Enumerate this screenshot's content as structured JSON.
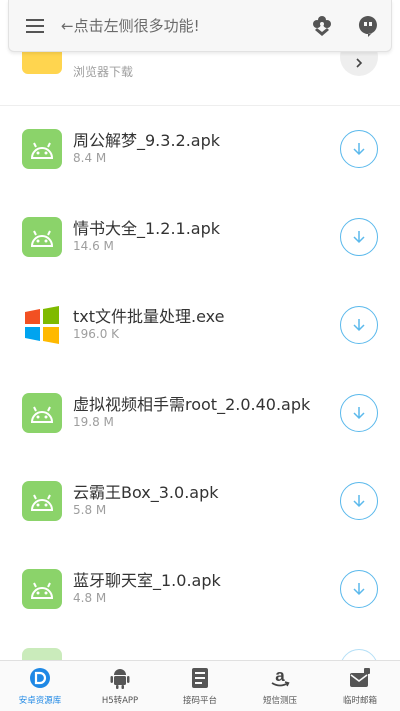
{
  "search": {
    "hint": "←点击左侧很多功能!"
  },
  "top_partial": {
    "subtitle": "浏览器下载"
  },
  "files": [
    {
      "name": "周公解梦_9.3.2.apk",
      "size": "8.4 M",
      "icon": "android-icon"
    },
    {
      "name": "情书大全_1.2.1.apk",
      "size": "14.6 M",
      "icon": "android-icon"
    },
    {
      "name": "txt文件批量处理.exe",
      "size": "196.0 K",
      "icon": "windows-icon"
    },
    {
      "name": "虚拟视频相手需root_2.0.40.apk",
      "size": "19.8 M",
      "icon": "android-icon"
    },
    {
      "name": "云霸王Box_3.0.apk",
      "size": "5.8 M",
      "icon": "android-icon"
    },
    {
      "name": "蓝牙聊天室_1.0.apk",
      "size": "4.8 M",
      "icon": "android-icon"
    }
  ],
  "nav": [
    {
      "label": "安卓资源库",
      "icon": "d-logo-icon",
      "active": true
    },
    {
      "label": "H5转APP",
      "icon": "android-icon"
    },
    {
      "label": "接码平台",
      "icon": "document-icon"
    },
    {
      "label": "短信测压",
      "icon": "amazon-icon"
    },
    {
      "label": "临时邮箱",
      "icon": "mail-icon"
    }
  ],
  "colors": {
    "accent": "#1e88e5",
    "download_ring": "#5bb9ec",
    "android_green": "#8bd36a",
    "folder_yellow": "#ffd54f"
  }
}
